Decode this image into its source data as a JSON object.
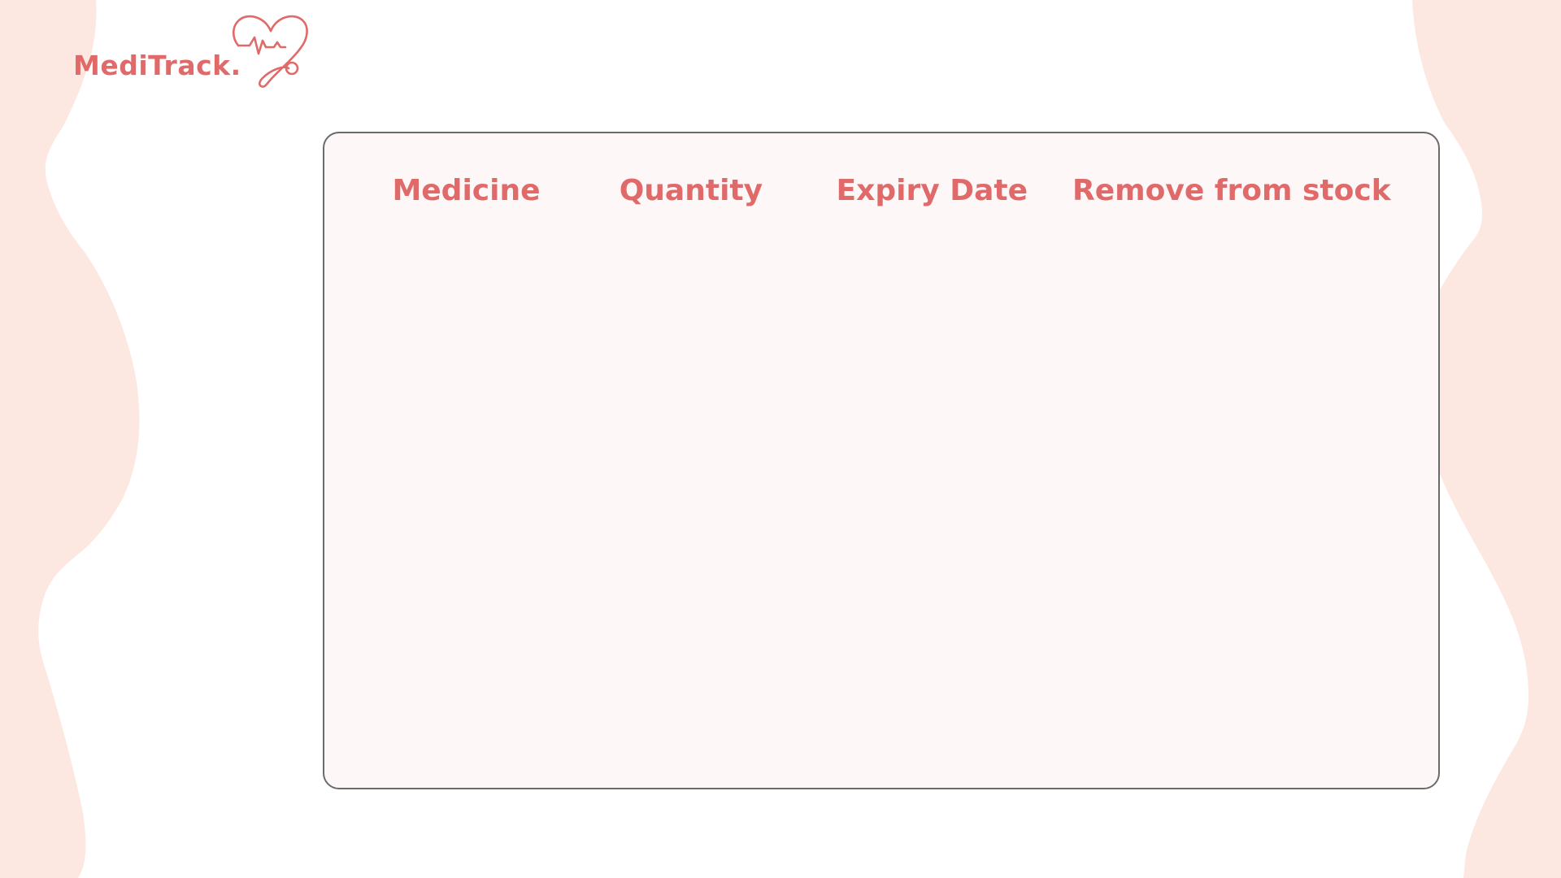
{
  "app": {
    "logo_text": "MediTrack.",
    "accent_color": "#e06a6a",
    "blob_color": "#fde8e1",
    "panel_background": "#fdf7f7",
    "logo_icon": "heartbeat-stethoscope-icon"
  },
  "table": {
    "columns": [
      {
        "label": "Medicine"
      },
      {
        "label": "Quantity"
      },
      {
        "label": "Expiry Date"
      },
      {
        "label": "Remove from stock"
      }
    ],
    "rows": []
  }
}
